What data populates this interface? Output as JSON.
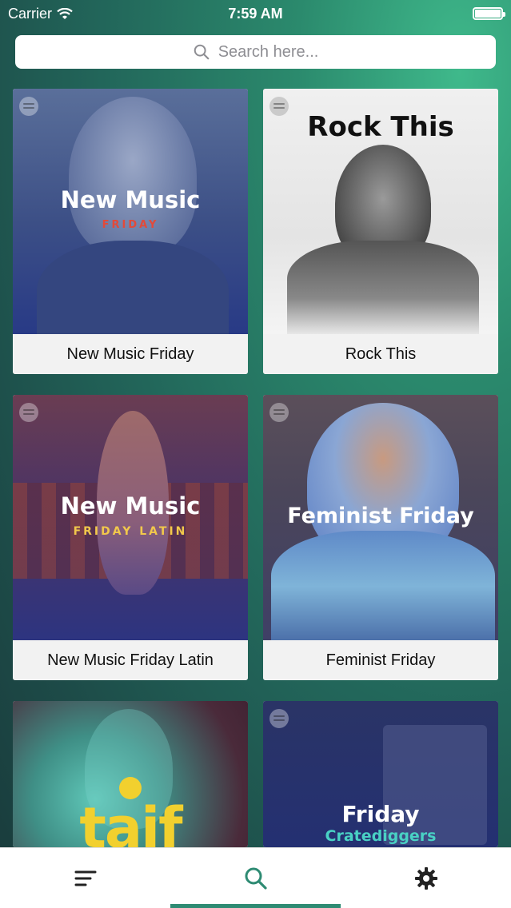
{
  "status_bar": {
    "carrier": "Carrier",
    "time": "7:59 AM"
  },
  "search": {
    "placeholder": "Search here..."
  },
  "playlists": [
    {
      "label": "New Music Friday",
      "art_title": "New Music",
      "art_subtitle": "FRIDAY"
    },
    {
      "label": "Rock This",
      "art_title": "Rock This"
    },
    {
      "label": "New Music Friday Latin",
      "art_title": "New Music",
      "art_subtitle": "FRIDAY LATIN"
    },
    {
      "label": "Feminist Friday",
      "art_title": "Feminist Friday"
    },
    {
      "art_title": "taif"
    },
    {
      "art_title": "Friday",
      "art_subtitle": "Cratediggers"
    }
  ],
  "tabs": [
    {
      "name": "browse",
      "icon": "menu-lines-icon"
    },
    {
      "name": "search",
      "icon": "search-icon",
      "active": true
    },
    {
      "name": "settings",
      "icon": "gear-icon"
    }
  ],
  "colors": {
    "accent": "#2e8b73"
  }
}
